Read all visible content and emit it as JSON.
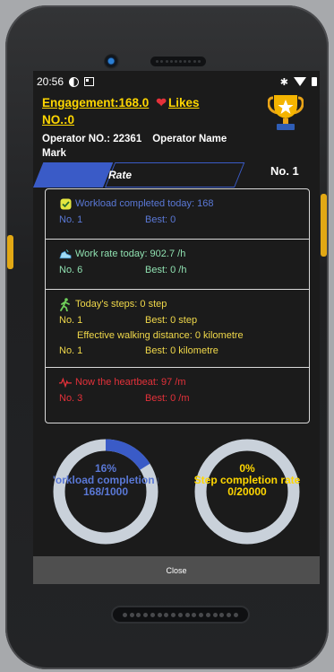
{
  "status_bar": {
    "time": "20:56"
  },
  "header": {
    "engagement": "Engagement:168.0",
    "likes": "Likes",
    "no_label": "NO.:0",
    "operator_no": "Operator NO.: 22361",
    "operator_name_label": "Operator Name",
    "operator_name": "Mark"
  },
  "tabs": {
    "active_label": "",
    "rate_label": "Rate",
    "rank": "No. 1"
  },
  "workload": {
    "title": "Workload completed today: 168",
    "rank": "No. 1",
    "best": "Best: 0"
  },
  "work_rate": {
    "title": "Work rate today:  902.7 /h",
    "rank": "No. 6",
    "best": "Best: 0 /h"
  },
  "steps": {
    "title": "Today's steps: 0 step",
    "rank": "No. 1",
    "best": "Best: 0 step",
    "distance_title": "Effective walking distance: 0 kilometre",
    "distance_rank": "No. 1",
    "distance_best": "Best: 0 kilometre"
  },
  "heartbeat": {
    "title": "Now the heartbeat: 97 /m",
    "rank": "No. 3",
    "best": "Best: 0 /m"
  },
  "rings": [
    {
      "percent": "16%",
      "label": "'orkload completion ra",
      "value": "168/1000",
      "fraction": 0.16,
      "color": "#3a5bc7"
    },
    {
      "percent": "0%",
      "label": "Step completion rate",
      "value": "0/20000",
      "fraction": 0.0,
      "color": "#ffd700"
    }
  ],
  "footer": {
    "close_label": "Close"
  },
  "colors": {
    "accent_blue": "#3a5bc7",
    "gold": "#ffd700",
    "heart_red": "#e4313a",
    "ring_track": "#c9d1da"
  }
}
